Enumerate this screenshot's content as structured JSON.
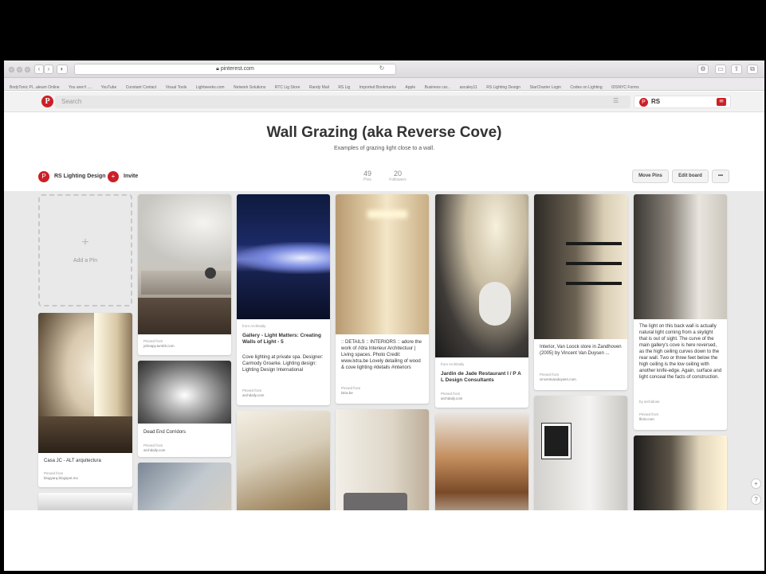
{
  "browser": {
    "url": "pinterest.com",
    "bookmarks": [
      "BodyTonic Pl...aleum Online",
      "You aren't ....",
      "YouTube",
      "Constant Contact",
      "Visual Tools",
      "Lightweeks.com",
      "Network Solutions",
      "RTC Lig Store",
      "Randy Mail",
      "RS Lig",
      "Imported Bookmarks",
      "Apple",
      "Business car...",
      "ascaley11",
      "RS Lighting Design",
      "StarCharter Login",
      "Codes on Lighting",
      "IDSNYC Forms"
    ]
  },
  "pinterest": {
    "logo": "P",
    "search_placeholder": "Search",
    "user_initials": "RS",
    "menu_glyph": "☰"
  },
  "board": {
    "title": "Wall Grazing (aka Reverse Cove)",
    "description": "Examples of grazing light close to a wall.",
    "owner_name": "RS Lighting Design",
    "invite_label": "Invite",
    "pins_count": "49",
    "pins_label": "Pins",
    "followers_count": "20",
    "followers_label": "Followers",
    "move_pins": "Move Pins",
    "edit_board": "Edit board",
    "more": "•••"
  },
  "add_pin": {
    "plus": "+",
    "label": "Add a Pin"
  },
  "pins": [
    {
      "caption": "Casa JC - ALT arquitectura",
      "pinned_from": "Pinned from",
      "source": "blogyarq.blogspot.mx"
    },
    {
      "pinned_from": "Pinned from",
      "source": "johnapy.tumblr.com"
    },
    {
      "caption": "Dead End Corridors",
      "pinned_from": "Pinned from",
      "source": "archdaily.com"
    },
    {
      "via": "from ArchDaily",
      "title": "Gallery - Light Matters: Creating Walls of Light - 5",
      "caption": "Cove lighting at private spa. Designer: Carmody Groarke. Lighting design: Lighting Design International",
      "pinned_from": "Pinned from",
      "source": "archdaily.com"
    },
    {
      "caption": ":: DETAILS :: INTERIORS :: adore the work of //dra Interieur Architectuur | Living spaces. Photo Credit: www.lxtra.be Lovely detailing of wood & cove lighting #details #interiors",
      "pinned_from": "Pinned from",
      "source": "lxtra.be"
    },
    {
      "via": "from ArchDaily",
      "title": "Jardin de Jade Restaurant I / P A L Design Consultants",
      "pinned_from": "Pinned from",
      "source": "archdaily.com"
    },
    {
      "caption": "Interior, Van Loock store in Zandhoven (2005) by Vincent Van Duysen ...",
      "pinned_from": "Pinned from",
      "source": "vincentvanduysen.com"
    },
    {
      "caption": "The light on this back wall is actually natural light coming from a skylight that is out of sight. The curve of the main gallery's cove is here reversed, as the high ceiling curves down to the rear wall. Two or three feet below the high ceiling is the low ceiling with another knife-edge. Again, surface and light conceal the facts of construction.",
      "via": "by archidose",
      "pinned_from": "Pinned from",
      "source": "flickr.com"
    }
  ],
  "side_buttons": {
    "add": "+",
    "help": "?"
  },
  "colors": {
    "brand_red": "#cb2027",
    "grid_bg": "#e9e9e9"
  }
}
